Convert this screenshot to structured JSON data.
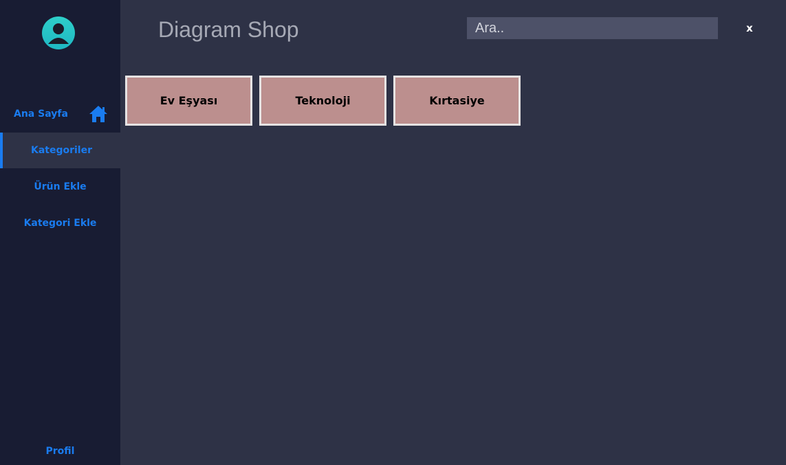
{
  "header": {
    "title": "Diagram Shop",
    "search_placeholder": "Ara..",
    "close_label": "x"
  },
  "sidebar": {
    "avatar_icon": "user-avatar-icon",
    "items": [
      {
        "label": "Ana Sayfa",
        "icon": "home-icon"
      },
      {
        "label": "Kategoriler",
        "active": true
      },
      {
        "label": "Ürün Ekle"
      },
      {
        "label": "Kategori Ekle"
      }
    ],
    "profile_label": "Profil"
  },
  "categories": [
    {
      "label": "Ev Eşyası"
    },
    {
      "label": "Teknoloji"
    },
    {
      "label": "Kırtasiye"
    }
  ],
  "colors": {
    "sidebar_bg": "#181c33",
    "main_bg": "#2e3246",
    "accent": "#1a7cf0",
    "category_button_bg": "#bc8f8e",
    "avatar": "#2ecfc9"
  }
}
